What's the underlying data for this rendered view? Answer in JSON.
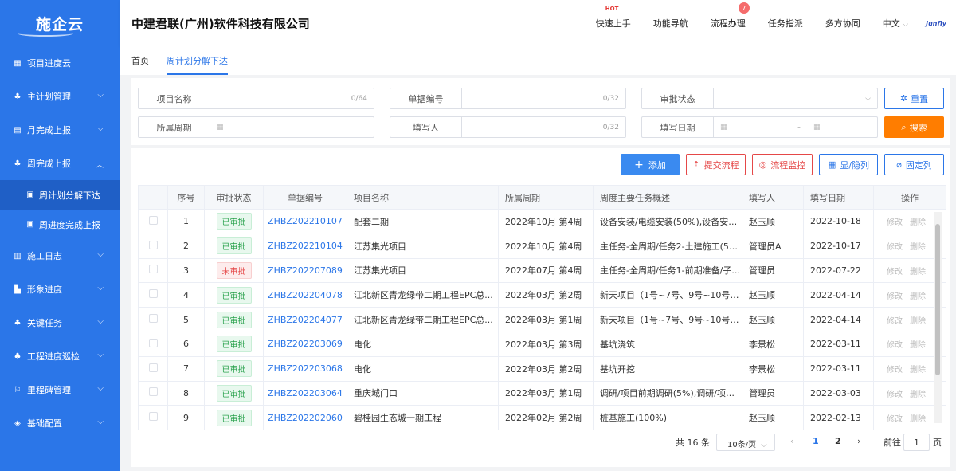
{
  "app": {
    "logo": "施企云"
  },
  "sidebar": {
    "items": [
      {
        "label": "项目进度云",
        "icon": "grid-icon"
      },
      {
        "label": "主计划管理",
        "icon": "sitemap-icon"
      },
      {
        "label": "月完成上报",
        "icon": "document-icon"
      },
      {
        "label": "周完成上报",
        "icon": "sitemap-icon"
      },
      {
        "label": "施工日志",
        "icon": "book-icon"
      },
      {
        "label": "形象进度",
        "icon": "building-icon"
      },
      {
        "label": "关键任务",
        "icon": "sitemap-icon"
      },
      {
        "label": "工程进度巡检",
        "icon": "sitemap-icon"
      },
      {
        "label": "里程碑管理",
        "icon": "milestone-icon"
      },
      {
        "label": "基础配置",
        "icon": "layers-icon"
      }
    ],
    "sub": [
      {
        "label": "周计划分解下达"
      },
      {
        "label": "周进度完成上报"
      }
    ]
  },
  "header": {
    "company": "中建君联(广州)软件科技有限公司",
    "nav": [
      "快速上手",
      "功能导航",
      "流程办理",
      "任务指派",
      "多方协同",
      "中文"
    ],
    "hot": "HOT",
    "badge": "7",
    "brand": "Junfly"
  },
  "tabs": [
    "首页",
    "周计划分解下达"
  ],
  "filters": {
    "project_name": {
      "label": "项目名称",
      "count": "0/64"
    },
    "doc_no": {
      "label": "单据编号",
      "count": "0/32"
    },
    "status": {
      "label": "审批状态"
    },
    "period": {
      "label": "所属周期"
    },
    "filler": {
      "label": "填写人",
      "count": "0/32"
    },
    "date": {
      "label": "填写日期",
      "sep": "-"
    },
    "reset": "重置",
    "search": "搜索"
  },
  "actions": {
    "add": "添加",
    "submit": "提交流程",
    "monitor": "流程监控",
    "toggle": "显/隐列",
    "fix": "固定列"
  },
  "table": {
    "headers": [
      "序号",
      "审批状态",
      "单据编号",
      "项目名称",
      "所属周期",
      "周度主要任务概述",
      "填写人",
      "填写日期",
      "操作"
    ],
    "edit": "修改",
    "delete": "删除",
    "rows": [
      {
        "no": "1",
        "status": "已审批",
        "ok": true,
        "code": "ZHBZ202210107",
        "project": "配套二期",
        "period": "2022年10月 第4周",
        "summary": "设备安装/电缆安装(50%),设备安装...",
        "user": "赵玉顺",
        "date": "2022-10-18"
      },
      {
        "no": "2",
        "status": "已审批",
        "ok": true,
        "code": "ZHBZ202210104",
        "project": "江苏集光项目",
        "period": "2022年10月 第4周",
        "summary": "主任务-全周期/任务2-土建施工(50...",
        "user": "管理员A",
        "date": "2022-10-17"
      },
      {
        "no": "3",
        "status": "未审批",
        "ok": false,
        "code": "ZHBZ202207089",
        "project": "江苏集光项目",
        "period": "2022年07月 第4周",
        "summary": "主任务-全周期/任务1-前期准备/子...",
        "user": "管理员",
        "date": "2022-07-22"
      },
      {
        "no": "4",
        "status": "已审批",
        "ok": true,
        "code": "ZHBZ202204078",
        "project": "江北新区青龙绿带二期工程EPC总...",
        "period": "2022年03月 第2周",
        "summary": "新天项目（1号~7号、9号~10号地...",
        "user": "赵玉顺",
        "date": "2022-04-14"
      },
      {
        "no": "5",
        "status": "已审批",
        "ok": true,
        "code": "ZHBZ202204077",
        "project": "江北新区青龙绿带二期工程EPC总...",
        "period": "2022年03月 第1周",
        "summary": "新天项目（1号~7号、9号~10号地...",
        "user": "赵玉顺",
        "date": "2022-04-14"
      },
      {
        "no": "6",
        "status": "已审批",
        "ok": true,
        "code": "ZHBZ202203069",
        "project": "电化",
        "period": "2022年03月 第3周",
        "summary": "基坑浇筑",
        "user": "李景松",
        "date": "2022-03-11"
      },
      {
        "no": "7",
        "status": "已审批",
        "ok": true,
        "code": "ZHBZ202203068",
        "project": "电化",
        "period": "2022年03月 第2周",
        "summary": "基坑开挖",
        "user": "李景松",
        "date": "2022-03-11"
      },
      {
        "no": "8",
        "status": "已审批",
        "ok": true,
        "code": "ZHBZ202203064",
        "project": "重庆城门口",
        "period": "2022年03月 第1周",
        "summary": "调研/项目前期调研(5%),调研/项目...",
        "user": "管理员",
        "date": "2022-03-03"
      },
      {
        "no": "9",
        "status": "已审批",
        "ok": true,
        "code": "ZHBZ202202060",
        "project": "碧桂园生态城一期工程",
        "period": "2022年02月 第2周",
        "summary": "桩基施工(100%)",
        "user": "赵玉顺",
        "date": "2022-02-13"
      }
    ]
  },
  "pager": {
    "total": "共 16 条",
    "size": "10条/页",
    "pages": [
      "1",
      "2"
    ],
    "goto": "前往",
    "page": "1",
    "unit": "页"
  }
}
